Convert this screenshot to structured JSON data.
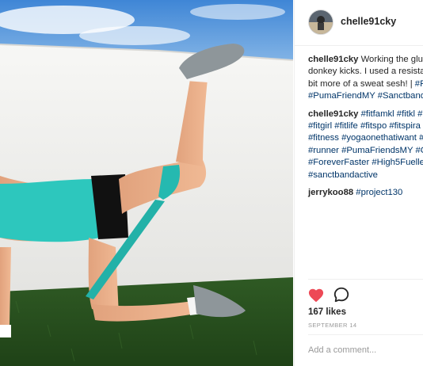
{
  "post": {
    "username": "chelle91cky",
    "avatar_icon": "profile-photo-icon",
    "photo_icon": "exercise-photo-icon"
  },
  "comments": [
    {
      "username": "chelle91cky",
      "lines": [
        [
          {
            "text": "Working the glut",
            "tag": false
          }
        ],
        [
          {
            "text": "donkey kicks. I used a resista",
            "tag": false
          }
        ],
        [
          {
            "text": "bit more of a sweat sesh! | ",
            "tag": false
          },
          {
            "text": "#P",
            "tag": true
          }
        ],
        [
          {
            "text": "#PumaFriendMY",
            "tag": true
          },
          {
            "text": " ",
            "tag": false
          },
          {
            "text": "#Sanctband",
            "tag": true
          }
        ]
      ]
    },
    {
      "username": "chelle91cky",
      "lines": [
        [
          {
            "text": "#fitfamkl",
            "tag": true
          },
          {
            "text": " ",
            "tag": false
          },
          {
            "text": "#fitkl",
            "tag": true
          },
          {
            "text": " ",
            "tag": false
          },
          {
            "text": "#",
            "tag": true
          }
        ],
        [
          {
            "text": "#fitgirl",
            "tag": true
          },
          {
            "text": " ",
            "tag": false
          },
          {
            "text": "#fitlife",
            "tag": true
          },
          {
            "text": " ",
            "tag": false
          },
          {
            "text": "#fitspo",
            "tag": true
          },
          {
            "text": " ",
            "tag": false
          },
          {
            "text": "#fitspira",
            "tag": true
          }
        ],
        [
          {
            "text": "#fitness",
            "tag": true
          },
          {
            "text": " ",
            "tag": false
          },
          {
            "text": "#yogaonethatiwant",
            "tag": true
          },
          {
            "text": " ",
            "tag": false
          },
          {
            "text": "#",
            "tag": true
          }
        ],
        [
          {
            "text": "#runner",
            "tag": true
          },
          {
            "text": " ",
            "tag": false
          },
          {
            "text": "#PumaFriendsMY",
            "tag": true
          },
          {
            "text": " ",
            "tag": false
          },
          {
            "text": "#C",
            "tag": true
          }
        ],
        [
          {
            "text": "#ForeverFaster",
            "tag": true
          },
          {
            "text": " ",
            "tag": false
          },
          {
            "text": "#High5Fuelle",
            "tag": true
          }
        ],
        [
          {
            "text": "#sanctbandactive",
            "tag": true
          }
        ]
      ]
    },
    {
      "username": "jerrykoo88",
      "lines": [
        [
          {
            "text": "#project130",
            "tag": true
          }
        ]
      ]
    }
  ],
  "actions": {
    "like_icon": "heart-icon",
    "comment_icon": "comment-bubble-icon",
    "liked": true,
    "like_color": "#ed4956"
  },
  "likes": "167 likes",
  "date": "SEPTEMBER 14",
  "add_comment": {
    "placeholder": "Add a comment...",
    "value": ""
  },
  "colors": {
    "hashtag": "#003569",
    "text": "#262626",
    "muted": "#999999",
    "border": "#efefef"
  }
}
